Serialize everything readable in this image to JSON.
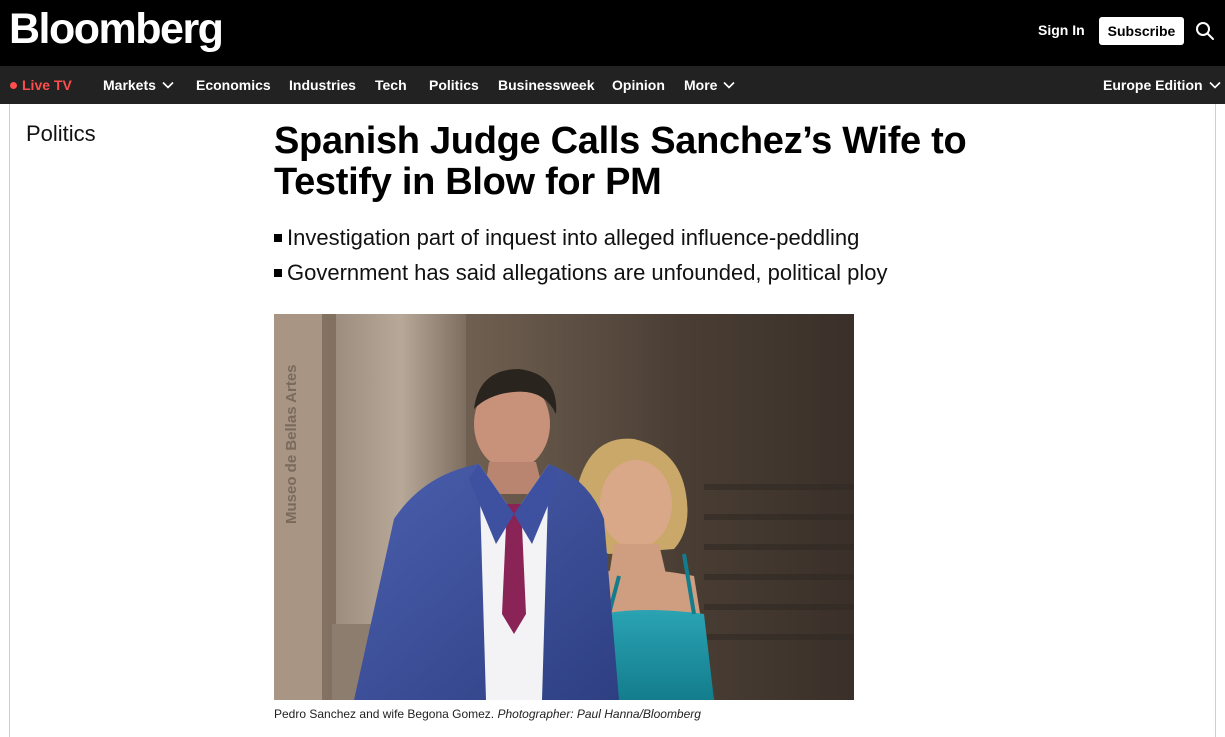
{
  "header": {
    "logo": "Bloomberg",
    "sign_in": "Sign In",
    "subscribe": "Subscribe",
    "search_icon": "search-icon"
  },
  "nav": {
    "live_tv": "Live TV",
    "items": [
      "Markets",
      "Economics",
      "Industries",
      "Tech",
      "Politics",
      "Businessweek",
      "Opinion",
      "More"
    ],
    "edition": "Europe Edition"
  },
  "article": {
    "section": "Politics",
    "headline": "Spanish Judge Calls Sanchez’s Wife to Testify in Blow for PM",
    "bullets": [
      "Investigation part of inquest into alleged influence-peddling",
      "Government has said allegations are unfounded, political ploy"
    ],
    "photo": {
      "caption": "Pedro Sanchez and wife Begona Gomez.",
      "credit": "Photographer: Paul Hanna/Bloomberg",
      "wall_text": "Museo de Bellas Artes"
    }
  },
  "colors": {
    "topbar": "#000000",
    "navbar": "#222222",
    "live_red": "#ff4d4d"
  }
}
